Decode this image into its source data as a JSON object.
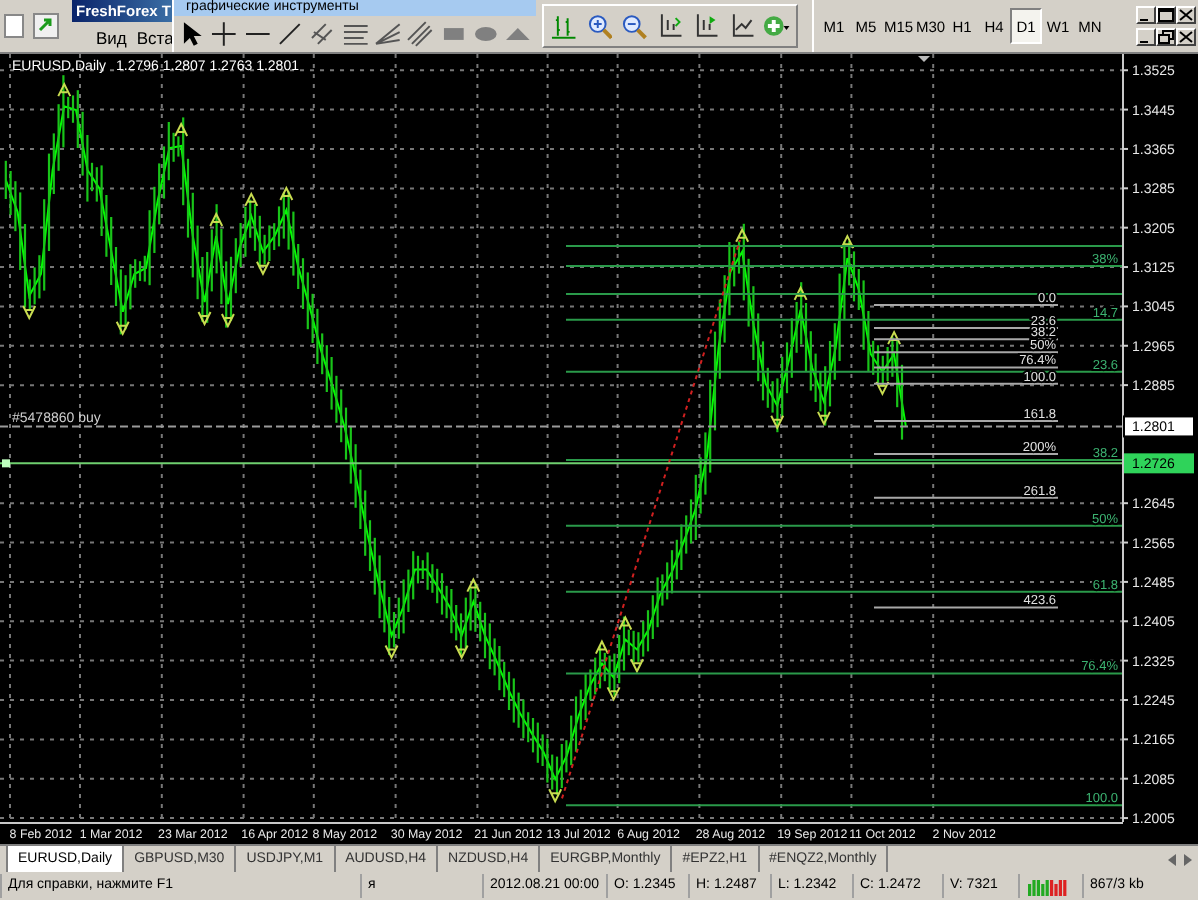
{
  "terminal": {
    "title": "FreshForex T",
    "menu": [
      "Вид",
      "Вста"
    ]
  },
  "drawing_toolbar": {
    "title": "графические инструменты"
  },
  "timeframes": [
    {
      "label": "M1",
      "selected": false
    },
    {
      "label": "M5",
      "selected": false
    },
    {
      "label": "M15",
      "selected": false
    },
    {
      "label": "M30",
      "selected": false
    },
    {
      "label": "H1",
      "selected": false
    },
    {
      "label": "H4",
      "selected": false
    },
    {
      "label": "D1",
      "selected": true
    },
    {
      "label": "W1",
      "selected": false
    },
    {
      "label": "MN",
      "selected": false
    }
  ],
  "chart": {
    "quote": "1.2796 1.2807 1.2763 1.2801",
    "chart_data": {
      "type": "line",
      "title": "EURUSD,Daily",
      "grid": true,
      "categories": [
        null,
        null,
        null,
        "8 Feb 2012",
        null,
        null,
        null,
        null,
        null,
        "1 Mar 2012",
        null,
        null,
        null,
        null,
        null,
        null,
        "23 Mar 2012",
        null,
        null,
        null,
        null,
        null,
        null,
        "16 Apr 2012",
        null,
        null,
        null,
        null,
        null,
        "8 May 2012",
        null,
        null,
        null,
        null,
        null,
        null,
        "30 May 2012",
        null,
        null,
        null,
        null,
        null,
        null,
        "21 Jun 2012",
        null,
        null,
        null,
        null,
        null,
        "13 Jul 2012",
        null,
        null,
        null,
        null,
        null,
        "6 Aug 2012",
        null,
        null,
        null,
        null,
        null,
        null,
        "28 Aug 2012",
        null,
        null,
        null,
        null,
        null,
        null,
        "19 Sep 2012",
        null,
        null,
        null,
        null,
        null,
        "11 Oct 2012",
        null,
        null,
        null,
        null,
        null,
        null,
        "2 Nov 2012",
        null,
        null,
        null,
        null,
        null,
        null,
        null,
        null,
        null,
        null,
        null,
        null,
        null
      ],
      "series": [
        {
          "color": "#00ff00",
          "values": [
            1.3302,
            1.3237,
            1.3066,
            1.3111,
            1.3322,
            1.3452,
            1.3444,
            1.3322,
            1.3285,
            1.316,
            1.3034,
            1.3111,
            1.3123,
            1.3261,
            1.3367,
            1.3371,
            1.3188,
            1.3054,
            1.3188,
            1.305,
            1.3164,
            1.3229,
            1.3156,
            1.3188,
            1.3241,
            1.3127,
            1.3042,
            1.2953,
            1.288,
            1.2798,
            1.2693,
            1.2575,
            1.2473,
            1.2376,
            1.2433,
            1.251,
            1.251,
            1.2473,
            1.2433,
            1.2376,
            1.2445,
            1.2376,
            1.2323,
            1.2266,
            1.2218,
            1.2177,
            1.214,
            1.2084,
            1.2132,
            1.2213,
            1.2275,
            1.2319,
            1.2291,
            1.2368,
            1.2348,
            1.2388,
            1.2461,
            1.2506,
            1.2567,
            1.2632,
            1.2741,
            1.2965,
            1.3115,
            1.3156,
            1.3005,
            1.2888,
            1.2843,
            1.2936,
            1.3038,
            1.292,
            1.2851,
            1.2961,
            1.3143,
            1.3078,
            1.2948,
            1.2912,
            1.2948,
            1.2802,
            null,
            null,
            null,
            null,
            null,
            null,
            null,
            null,
            null,
            null,
            null,
            null,
            null,
            null,
            null,
            null,
            null,
            null
          ]
        }
      ],
      "ylim": [
        1.1997,
        1.3558
      ],
      "yticks": [
        {
          "value": 1.3525,
          "label": "1.3525"
        },
        {
          "value": 1.3445,
          "label": "1.3445"
        },
        {
          "value": 1.3365,
          "label": "1.3365"
        },
        {
          "value": 1.3285,
          "label": "1.3285"
        },
        {
          "value": 1.3205,
          "label": "1.3205"
        },
        {
          "value": 1.3125,
          "label": "1.3125"
        },
        {
          "value": 1.3045,
          "label": "1.3045"
        },
        {
          "value": 1.2965,
          "label": "1.2965"
        },
        {
          "value": 1.2885,
          "label": "1.2885"
        },
        {
          "value": 1.2645,
          "label": "1.2645"
        },
        {
          "value": 1.2565,
          "label": "1.2565"
        },
        {
          "value": 1.2485,
          "label": "1.2485"
        },
        {
          "value": 1.2405,
          "label": "1.2405"
        },
        {
          "value": 1.2325,
          "label": "1.2325"
        },
        {
          "value": 1.2245,
          "label": "1.2245"
        },
        {
          "value": 1.2165,
          "label": "1.2165"
        },
        {
          "value": 1.2085,
          "label": "1.2085"
        },
        {
          "value": 1.2005,
          "label": "1.2005"
        }
      ]
    },
    "overlays": {
      "levels": [
        "38%",
        "14.7",
        "23.6",
        "38.2",
        "50%",
        "61.8",
        "76.4%",
        "100.0"
      ],
      "fibo": [
        "0.0",
        "23.6",
        "38.2",
        "50%",
        "76.4%",
        "100.0",
        "161.8",
        "200%",
        "261.8",
        "423.6"
      ],
      "order": "#5478860 buy",
      "tags": [
        "1.2801",
        "1.2726"
      ]
    }
  },
  "tabs": [
    {
      "label": "EURUSD,Daily",
      "selected": true
    },
    {
      "label": "GBPUSD,M30",
      "selected": false
    },
    {
      "label": "USDJPY,M1",
      "selected": false
    },
    {
      "label": "AUDUSD,H4",
      "selected": false
    },
    {
      "label": "NZDUSD,H4",
      "selected": false
    },
    {
      "label": "EURGBP,Monthly",
      "selected": false
    },
    {
      "label": "#EPZ2,H1",
      "selected": false
    },
    {
      "label": "#ENQZ2,Monthly",
      "selected": false
    }
  ],
  "status_bar": {
    "help": "Для справки, нажмите F1",
    "profile": "я",
    "time": "2012.08.21 00:00",
    "open": "O: 1.2345",
    "high": "H: 1.2487",
    "low": "L: 1.2342",
    "close": "C: 1.2472",
    "volume": "V: 7321",
    "traffic": "867/3 kb"
  }
}
